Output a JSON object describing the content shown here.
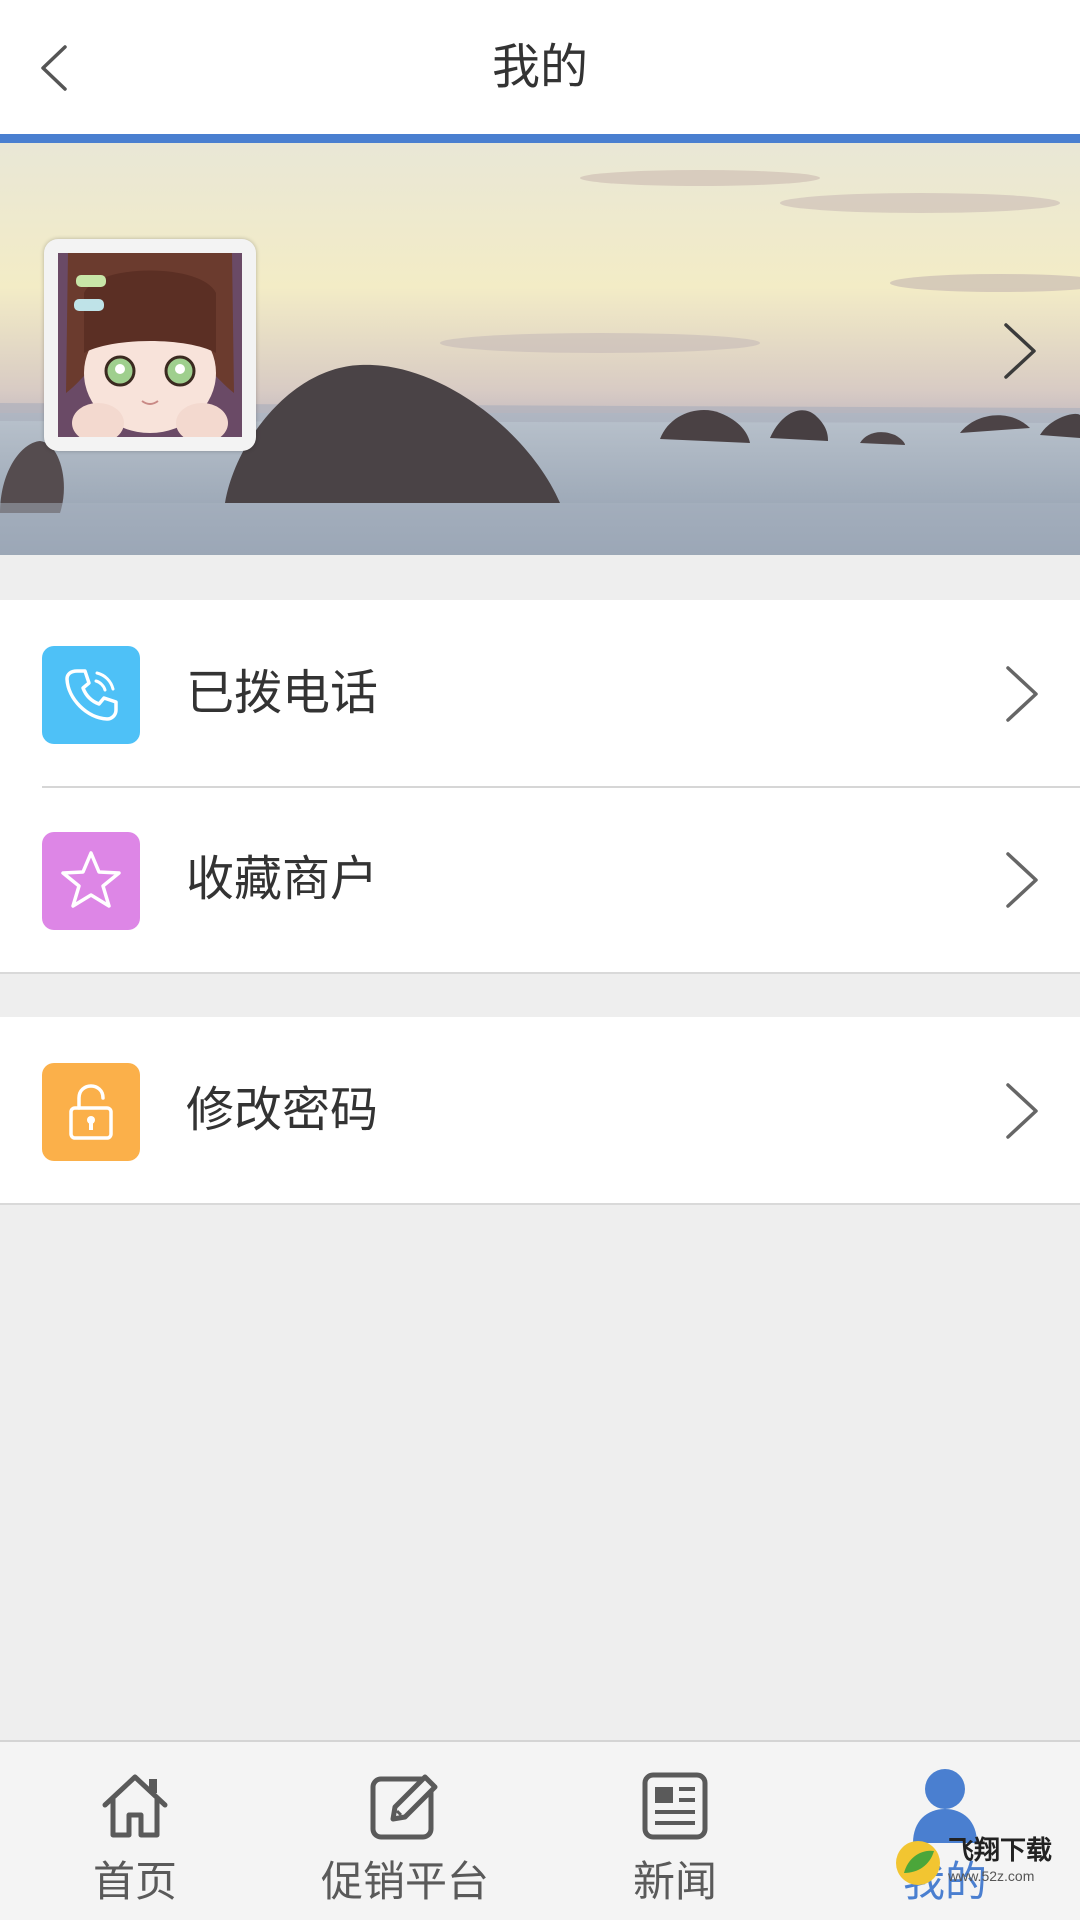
{
  "header": {
    "title": "我的",
    "back_icon": "chevron-left-icon"
  },
  "profile": {
    "banner_icon": "chevron-right-icon",
    "avatar": "avatar"
  },
  "menu": {
    "group1": [
      {
        "label": "已拨电话",
        "icon": "phone-icon",
        "color": "#4ec1f7"
      },
      {
        "label": "收藏商户",
        "icon": "star-icon",
        "color": "#dd86e6"
      }
    ],
    "group2": [
      {
        "label": "修改密码",
        "icon": "lock-icon",
        "color": "#fbb04a"
      }
    ]
  },
  "tabbar": {
    "tabs": [
      {
        "label": "首页",
        "icon": "home-icon"
      },
      {
        "label": "促销平台",
        "icon": "edit-icon"
      },
      {
        "label": "新闻",
        "icon": "news-icon"
      },
      {
        "label": "我的",
        "icon": "user-icon",
        "active": true
      }
    ]
  },
  "watermark": {
    "text": "飞翔下载",
    "url": "www.52z.com"
  },
  "colors": {
    "accent": "#4a7fd0",
    "background": "#eeeeee"
  }
}
